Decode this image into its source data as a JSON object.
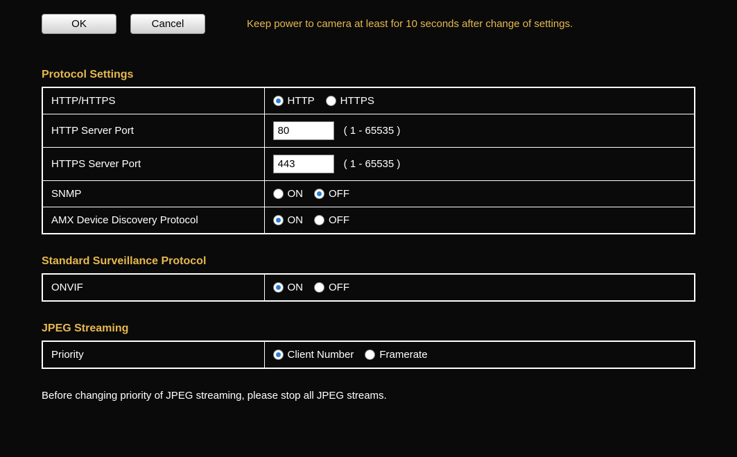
{
  "buttons": {
    "ok": "OK",
    "cancel": "Cancel"
  },
  "hint": "Keep power to camera at least for 10 seconds after change of settings.",
  "sections": {
    "protocol": {
      "title": "Protocol Settings",
      "rows": {
        "httpHttps": {
          "label": "HTTP/HTTPS",
          "opt1": "HTTP",
          "opt2": "HTTPS"
        },
        "httpPort": {
          "label": "HTTP Server Port",
          "value": "80",
          "range": "( 1 - 65535 )"
        },
        "httpsPort": {
          "label": "HTTPS Server Port",
          "value": "443",
          "range": "( 1 - 65535 )"
        },
        "snmp": {
          "label": "SNMP",
          "opt1": "ON",
          "opt2": "OFF"
        },
        "amx": {
          "label": "AMX Device Discovery Protocol",
          "opt1": "ON",
          "opt2": "OFF"
        }
      }
    },
    "surveillance": {
      "title": "Standard Surveillance Protocol",
      "rows": {
        "onvif": {
          "label": "ONVIF",
          "opt1": "ON",
          "opt2": "OFF"
        }
      }
    },
    "jpeg": {
      "title": "JPEG Streaming",
      "rows": {
        "priority": {
          "label": "Priority",
          "opt1": "Client Number",
          "opt2": "Framerate"
        }
      }
    }
  },
  "footerNote": "Before changing priority of JPEG streaming, please stop all JPEG streams."
}
